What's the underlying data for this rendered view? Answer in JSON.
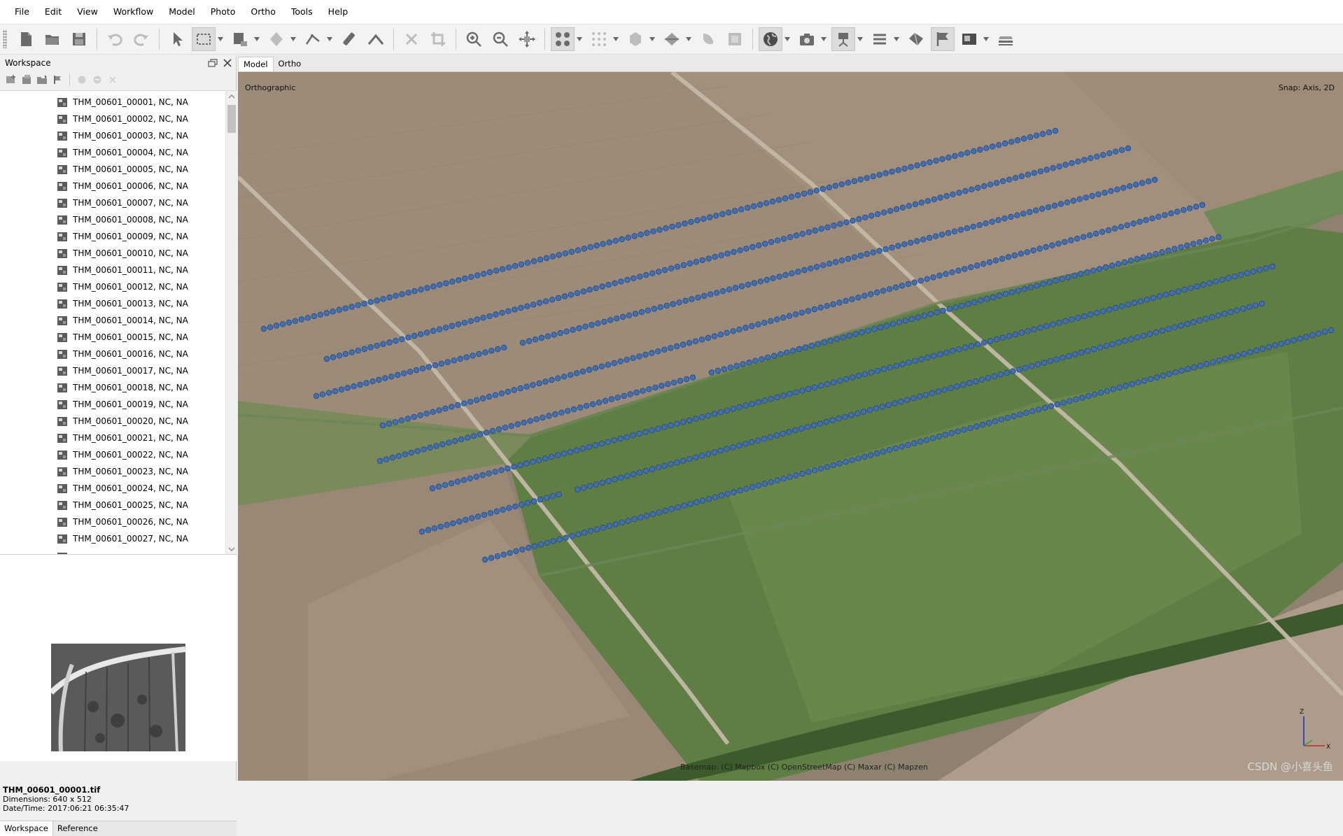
{
  "menu": [
    "File",
    "Edit",
    "View",
    "Workflow",
    "Model",
    "Photo",
    "Ortho",
    "Tools",
    "Help"
  ],
  "toolbar": {
    "icons": [
      "new-document-icon",
      "open-folder-icon",
      "save-icon",
      "undo-icon",
      "redo-icon",
      "pointer-icon",
      "rectangle-selection-icon",
      "resize-region-icon",
      "rotate-object-icon",
      "ruler-icon",
      "shape-icon",
      "delete-icon",
      "crop-icon",
      "zoom-in-icon",
      "zoom-out-icon",
      "reset-view-icon",
      "show-cameras-icon",
      "show-points-icon",
      "show-model-icon",
      "show-mesh-icon",
      "show-texture-icon",
      "show-dem-icon",
      "basemap-globe-icon",
      "camera-icon",
      "camera-tripod-icon",
      "layers-menu-icon",
      "shapes-icon",
      "markers-flag-icon",
      "image-display-icon",
      "dem-layers-icon"
    ]
  },
  "workspace": {
    "title": "Workspace",
    "photos": [
      "THM_00601_00001, NC, NA",
      "THM_00601_00002, NC, NA",
      "THM_00601_00003, NC, NA",
      "THM_00601_00004, NC, NA",
      "THM_00601_00005, NC, NA",
      "THM_00601_00006, NC, NA",
      "THM_00601_00007, NC, NA",
      "THM_00601_00008, NC, NA",
      "THM_00601_00009, NC, NA",
      "THM_00601_00010, NC, NA",
      "THM_00601_00011, NC, NA",
      "THM_00601_00012, NC, NA",
      "THM_00601_00013, NC, NA",
      "THM_00601_00014, NC, NA",
      "THM_00601_00015, NC, NA",
      "THM_00601_00016, NC, NA",
      "THM_00601_00017, NC, NA",
      "THM_00601_00018, NC, NA",
      "THM_00601_00019, NC, NA",
      "THM_00601_00020, NC, NA",
      "THM_00601_00021, NC, NA",
      "THM_00601_00022, NC, NA",
      "THM_00601_00023, NC, NA",
      "THM_00601_00024, NC, NA",
      "THM_00601_00025, NC, NA",
      "THM_00601_00026, NC, NA",
      "THM_00601_00027, NC, NA"
    ],
    "preview": {
      "filename": "THM_00601_00001.tif",
      "dimensions": "Dimensions: 640 x 512",
      "datetime": "Date/Time: 2017:06:21 06:35:47"
    },
    "tabs": [
      "Workspace",
      "Reference"
    ]
  },
  "model_view": {
    "tabs": [
      "Model",
      "Ortho"
    ],
    "projection": "Orthographic",
    "snap": "Snap: Axis, 2D",
    "basemap_credit": "Basemap: (C) Mapbox (C) OpenStreetMap (C) Maxar (C) Mapzen",
    "watermark": "CSDN @小喜头鱼",
    "axis_labels": {
      "z": "Z",
      "x": "X"
    },
    "camera_marker_color": "#3f6fb6"
  }
}
